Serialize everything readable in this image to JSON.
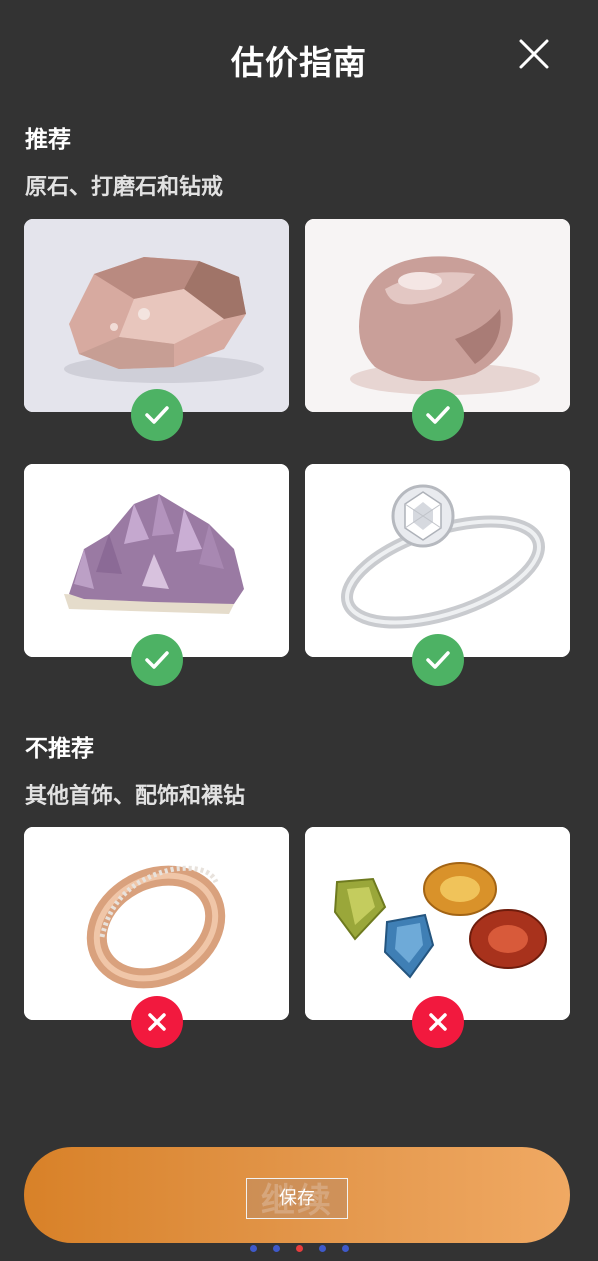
{
  "header": {
    "title": "估价指南"
  },
  "recommended": {
    "title": "推荐",
    "subtitle": "原石、打磨石和钻戒",
    "items": [
      {
        "subject": "rough-stone",
        "status": "ok"
      },
      {
        "subject": "polished-stone",
        "status": "ok"
      },
      {
        "subject": "amethyst-crystal",
        "status": "ok"
      },
      {
        "subject": "diamond-ring",
        "status": "ok"
      }
    ]
  },
  "not_recommended": {
    "title": "不推荐",
    "subtitle": "其他首饰、配饰和裸钻",
    "items": [
      {
        "subject": "rose-gold-band",
        "status": "no"
      },
      {
        "subject": "loose-gemstones",
        "status": "no"
      }
    ]
  },
  "footer": {
    "continue_label": "继续",
    "save_label": "保存",
    "page_dots": 5,
    "active_dot": 3
  },
  "colors": {
    "background": "#333333",
    "ok": "#4db264",
    "no": "#f2193e",
    "button_start": "#d88128",
    "button_end": "#f0a963"
  }
}
